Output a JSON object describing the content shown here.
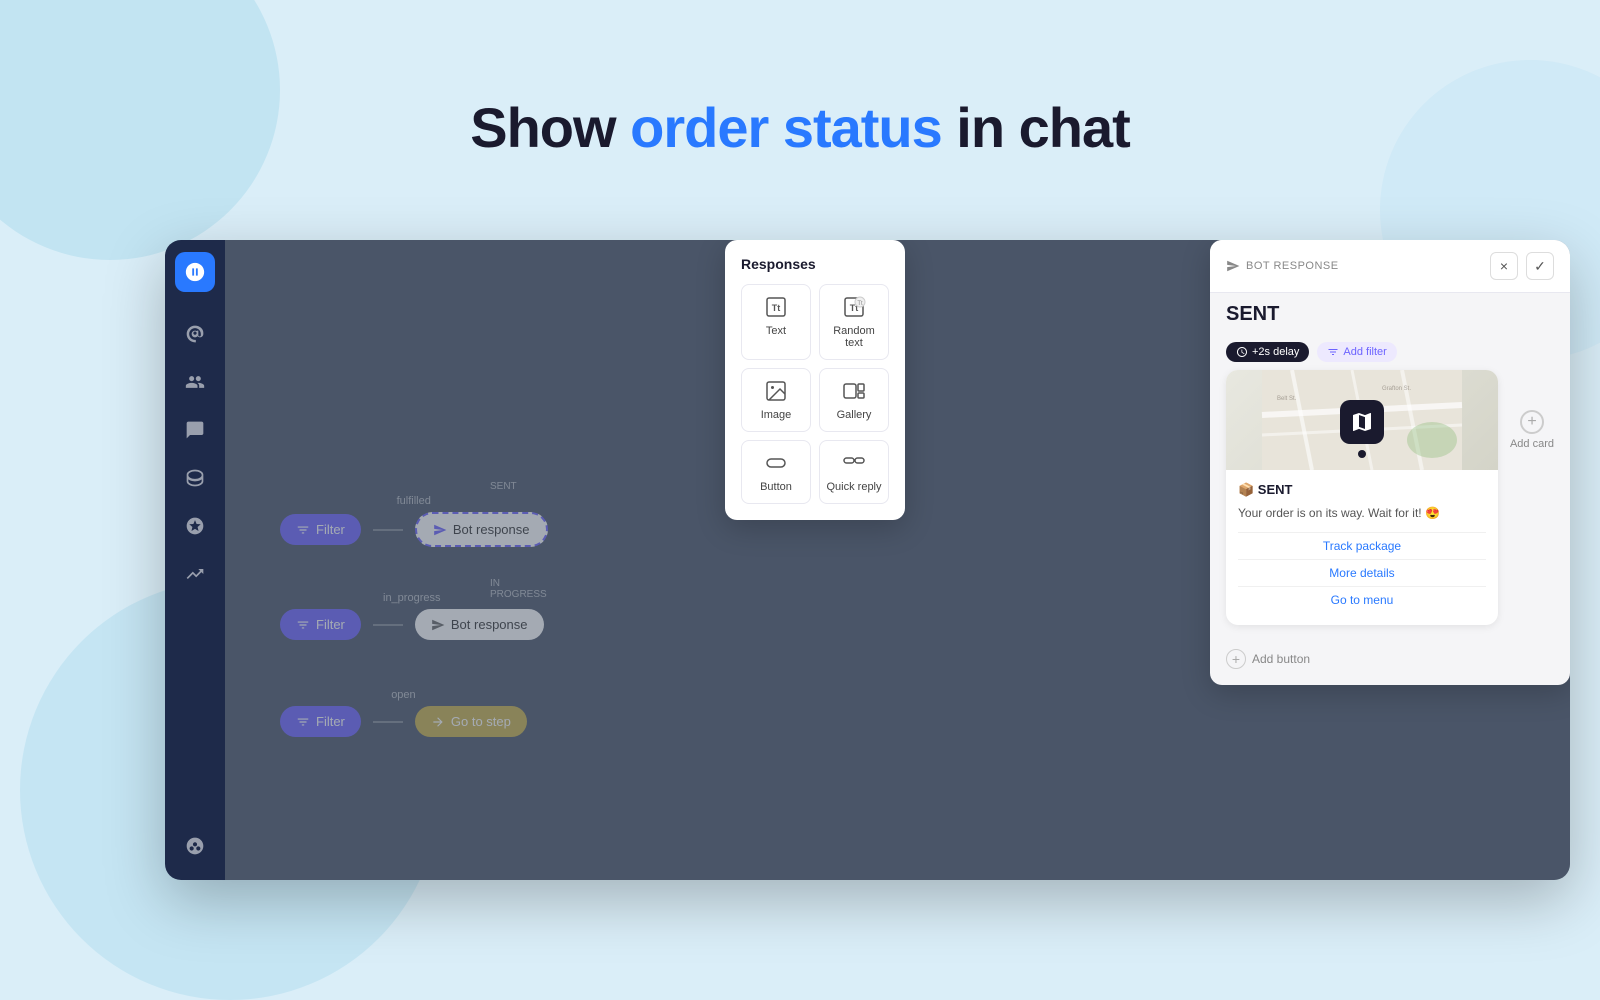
{
  "page": {
    "title_part1": "Show ",
    "title_highlight": "order status",
    "title_part2": " in chat"
  },
  "sidebar": {
    "items": [
      {
        "name": "chat-icon",
        "label": "Chat"
      },
      {
        "name": "org-chart-icon",
        "label": "Org chart"
      },
      {
        "name": "users-icon",
        "label": "Users"
      },
      {
        "name": "messages-icon",
        "label": "Messages"
      },
      {
        "name": "database-icon",
        "label": "Database"
      },
      {
        "name": "analytics-icon",
        "label": "Analytics"
      },
      {
        "name": "trends-icon",
        "label": "Trends"
      },
      {
        "name": "settings-icon",
        "label": "Settings"
      }
    ]
  },
  "canvas": {
    "rows": [
      {
        "label": "fulfilled",
        "filter_text": "Filter",
        "response_text": "Bot response",
        "response_status": "SENT",
        "is_active": true
      },
      {
        "label": "in_progress",
        "filter_text": "Filter",
        "response_text": "Bot response",
        "response_status": "IN PROGRESS",
        "is_active": false
      },
      {
        "label": "open",
        "filter_text": "Filter",
        "response_text": "Go to step",
        "response_status": "open",
        "is_active": false
      }
    ]
  },
  "responses_panel": {
    "title": "Responses",
    "items": [
      {
        "label": "Text",
        "icon": "text-icon"
      },
      {
        "label": "Random text",
        "icon": "random-text-icon"
      },
      {
        "label": "Image",
        "icon": "image-icon"
      },
      {
        "label": "Gallery",
        "icon": "gallery-icon"
      },
      {
        "label": "Button",
        "icon": "button-icon"
      },
      {
        "label": "Quick reply",
        "icon": "quick-reply-icon"
      }
    ]
  },
  "bot_response_panel": {
    "label": "BOT RESPONSE",
    "title": "SENT",
    "delay_tag": "+2s delay",
    "filter_tag": "Add filter",
    "card": {
      "emoji_title": "📦 SENT",
      "body": "Your order is on its way. Wait for it! 😍",
      "links": [
        "Track package",
        "More details",
        "Go to menu"
      ]
    },
    "add_card_label": "Add card",
    "add_button_label": "Add button",
    "close_label": "×",
    "confirm_label": "✓"
  }
}
